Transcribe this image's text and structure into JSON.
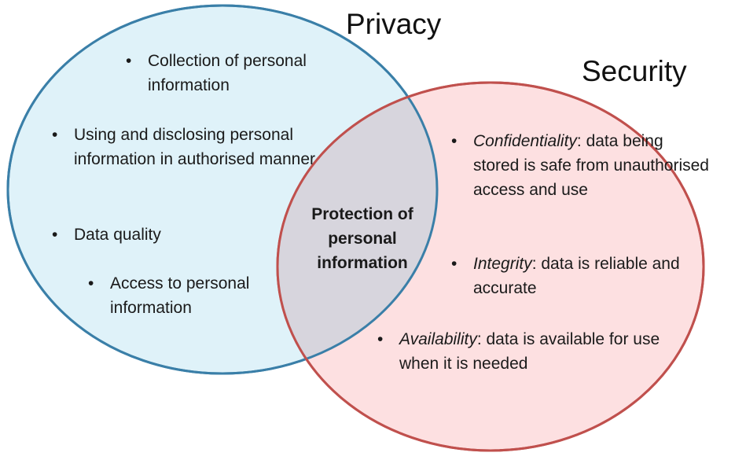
{
  "colors": {
    "privacy_fill": "#dff2f9",
    "privacy_stroke": "#3a7fa8",
    "security_fill": "#fde0e1",
    "security_stroke": "#c0504d",
    "overlap_fill": "#d7d5dd"
  },
  "privacy": {
    "title": "Privacy",
    "items": [
      "Collection of personal information",
      "Using and disclosing personal information in authorised manner",
      "Data quality",
      "Access to personal information"
    ]
  },
  "security": {
    "title": "Security",
    "items": [
      {
        "term": "Confidentiality",
        "text": ": data being stored is safe from unauthorised access and use"
      },
      {
        "term": "Integrity",
        "text": ": data is reliable and accurate"
      },
      {
        "term": "Availability",
        "text": ": data is available for use when it is needed"
      }
    ]
  },
  "overlap": {
    "label": "Protection of personal information"
  }
}
